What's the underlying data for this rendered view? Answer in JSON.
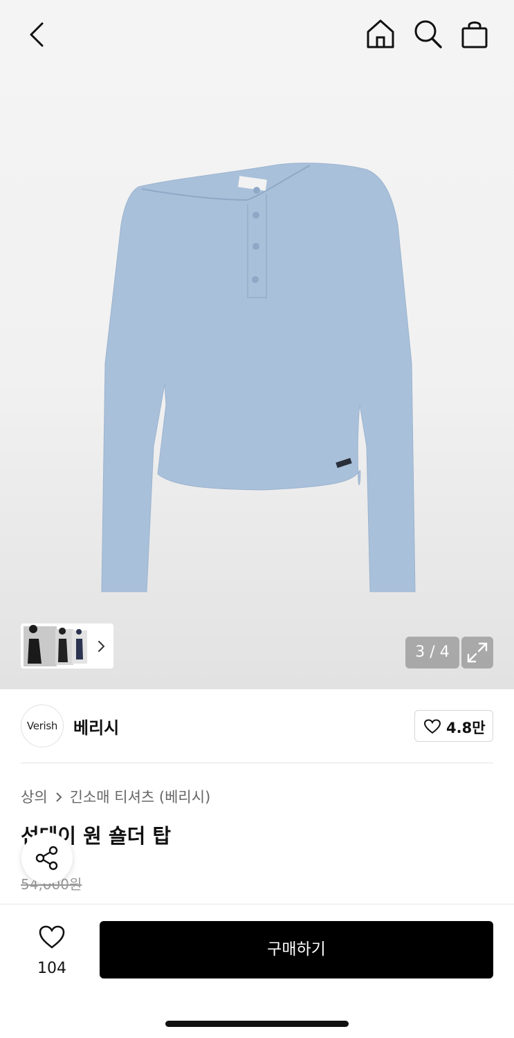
{
  "header": {
    "back_icon": "chevron-left-icon",
    "home_icon": "home-icon",
    "search_icon": "search-icon",
    "cart_icon": "shopping-bag-icon"
  },
  "gallery": {
    "counter": "3 / 4",
    "current_index": 3,
    "total": 4,
    "expand_icon": "expand-icon",
    "product_color": "#a9c0da"
  },
  "brand": {
    "logo_text": "Verish",
    "name": "베리시",
    "likes": "4.8만"
  },
  "breadcrumb": {
    "category": "상의",
    "subcategory": "긴소매 티셔츠 (베리시)"
  },
  "product": {
    "title": "선데이 원 숄더 탑",
    "original_price": "54,000원"
  },
  "bottom_bar": {
    "wish_count": "104",
    "buy_label": "구매하기"
  }
}
